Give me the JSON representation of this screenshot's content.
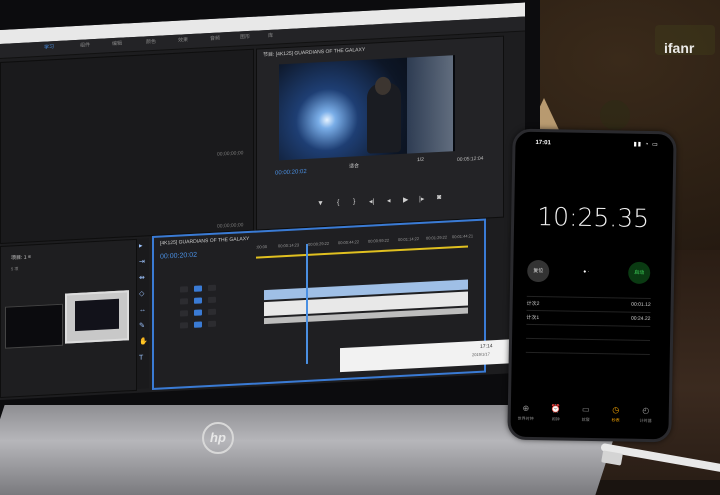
{
  "watermark": "ifanr",
  "laptop": {
    "brand_logo": "hp",
    "screen": {
      "menu_items": [
        "学习",
        "组件",
        "编辑",
        "颜色",
        "效果",
        "音频",
        "图形",
        "库"
      ],
      "active_menu_index": 0,
      "program_monitor": {
        "tab": "节目: [4K125] GUARDIANS OF THE GALAXY",
        "timecode_left": "00:00:20:02",
        "fit_label": "适合",
        "fraction_label": "1/2",
        "timecode_right": "00:05:12:04"
      },
      "source_monitor": {
        "timecode_top": "00;00;00;00",
        "timecode_bottom": "00;00;00;00"
      },
      "project_panel": {
        "tab": "项目: 1 ≡",
        "sub": "5 项"
      },
      "timeline": {
        "tab": "[4K125] GUARDIANS OF THE GALAXY",
        "timecode": "00:00:20:02",
        "ruler_ticks": [
          ":00:00",
          "00:00:14:23",
          "00:00:29:22",
          "00:00:44:22",
          "00:00:59:22",
          "00:01:14:22",
          "00:01:29:22",
          "00:01:44:21"
        ]
      },
      "taskbar": {
        "time": "17:14",
        "date": "2019/1/17"
      }
    }
  },
  "phone": {
    "status_time": "17:01",
    "status_icons": "▮▮ ◔ ▭",
    "stopwatch": "10:25.35",
    "reset_label": "复位",
    "start_label": "启动",
    "page_dots": "● ·",
    "laps": [
      {
        "label": "计次2",
        "time": "00:01.12"
      },
      {
        "label": "计次1",
        "time": "00:24.22"
      }
    ],
    "tabs": [
      {
        "icon": "world-clock-icon",
        "glyph": "⊕",
        "label": "世界时钟"
      },
      {
        "icon": "alarm-icon",
        "glyph": "⏰",
        "label": "闹钟"
      },
      {
        "icon": "bedtime-icon",
        "glyph": "▭",
        "label": "就寝"
      },
      {
        "icon": "stopwatch-icon",
        "glyph": "◷",
        "label": "秒表"
      },
      {
        "icon": "timer-icon",
        "glyph": "◴",
        "label": "计时器"
      }
    ],
    "active_tab_index": 3
  }
}
